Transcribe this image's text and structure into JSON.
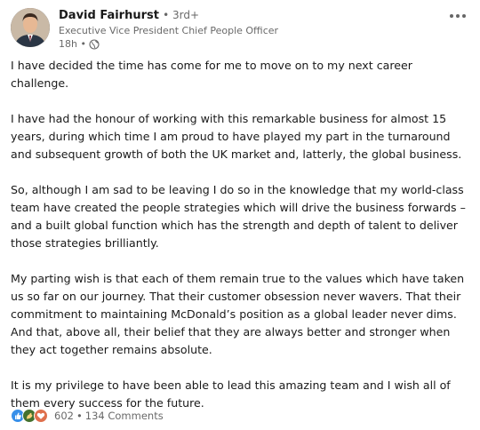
{
  "author": {
    "name": "David Fairhurst",
    "degree": "• 3rd+",
    "headline": "Executive Vice President Chief People Officer",
    "time": "18h •"
  },
  "post": {
    "paragraphs": [
      "I have decided the time has come for me to move on to my next career challenge.",
      "I have had the honour of working with this remarkable business for almost 15 years, during which time I am proud to have played my part in the turnaround and subsequent growth of both the UK market and, latterly, the global business.",
      "So, although I am sad to be leaving I do so in the knowledge that my world-class team have created the people strategies which will drive the business forwards – and a built global function which has the strength and depth of talent to deliver those strategies brilliantly.",
      "My parting wish is that each of them remain true to the values which have taken us so far on our journey. That their customer obsession never wavers. That their commitment to maintaining McDonald’s position as a global leader never dims. And that, above all, their belief that they are always better and stronger when they act together remains absolute.",
      "It is my privilege to have been able to lead this amazing team and I wish all of them every success for the future."
    ]
  },
  "social": {
    "reaction_count": "602",
    "separator": "•",
    "comments": "134 Comments"
  },
  "icons": {
    "like": "like-icon",
    "celebrate": "celebrate-icon",
    "love": "love-icon",
    "globe": "globe-icon",
    "more": "more-icon"
  },
  "colors": {
    "like": "#378fe9",
    "celebrate": "#44712e",
    "love": "#df704d"
  }
}
